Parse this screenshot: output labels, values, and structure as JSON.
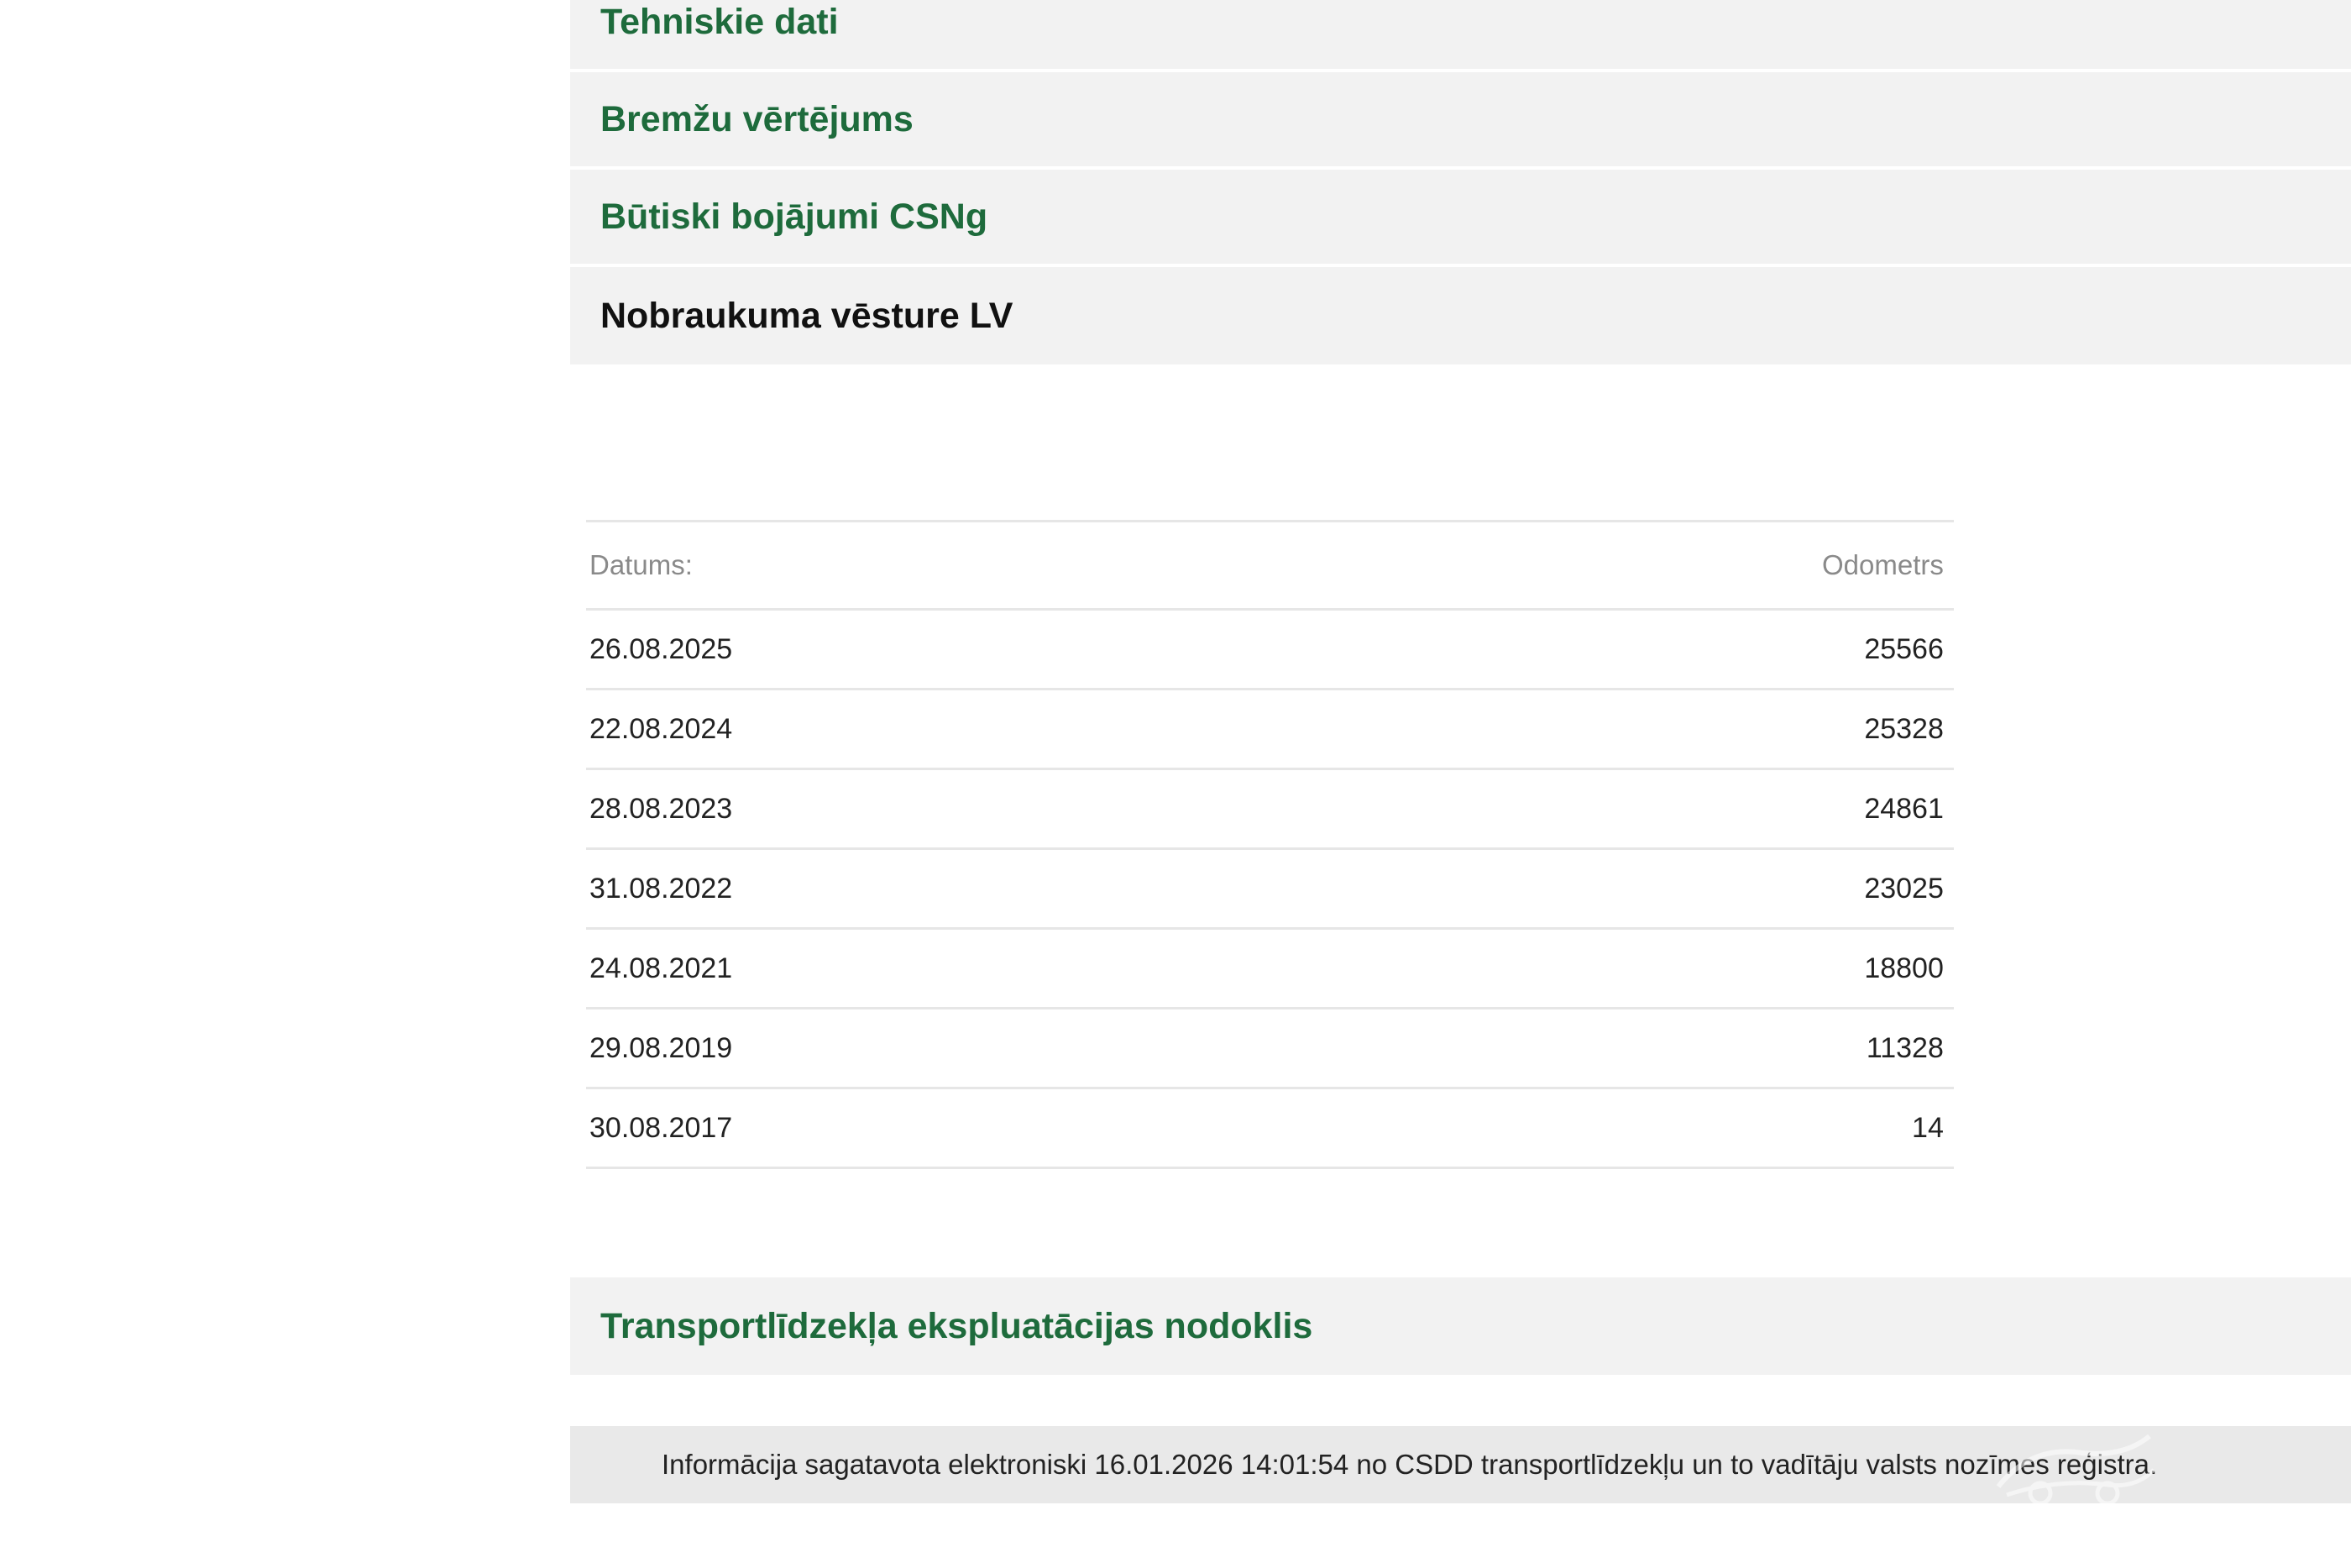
{
  "accordion": {
    "tehniskie_dati": "Tehniskie dati",
    "bremzu_vertejums": "Bremžu vērtējums",
    "butiski_bojajumi": "Būtiski bojājumi CSNg",
    "nobraukuma_vesture": "Nobraukuma vēsture LV",
    "nodoklis": "Transportlīdzekļa ekspluatācijas nodoklis"
  },
  "mileage_table": {
    "headers": {
      "date": "Datums:",
      "odometer": "Odometrs"
    },
    "rows": [
      {
        "date": "26.08.2025",
        "odometer": "25566"
      },
      {
        "date": "22.08.2024",
        "odometer": "25328"
      },
      {
        "date": "28.08.2023",
        "odometer": "24861"
      },
      {
        "date": "31.08.2022",
        "odometer": "23025"
      },
      {
        "date": "24.08.2021",
        "odometer": "18800"
      },
      {
        "date": "29.08.2019",
        "odometer": "11328"
      },
      {
        "date": "30.08.2017",
        "odometer": "14"
      }
    ]
  },
  "footer": {
    "text": "Informācija sagatavota elektroniski 16.01.2026 14:01:54 no CSDD transportlīdzekļu un to vadītāju valsts nozīmes reģistra."
  },
  "colors": {
    "accent_green": "#1e6b3c",
    "panel_bg": "#f2f2f2"
  },
  "watermark_icon": "car-logo-watermark-icon"
}
